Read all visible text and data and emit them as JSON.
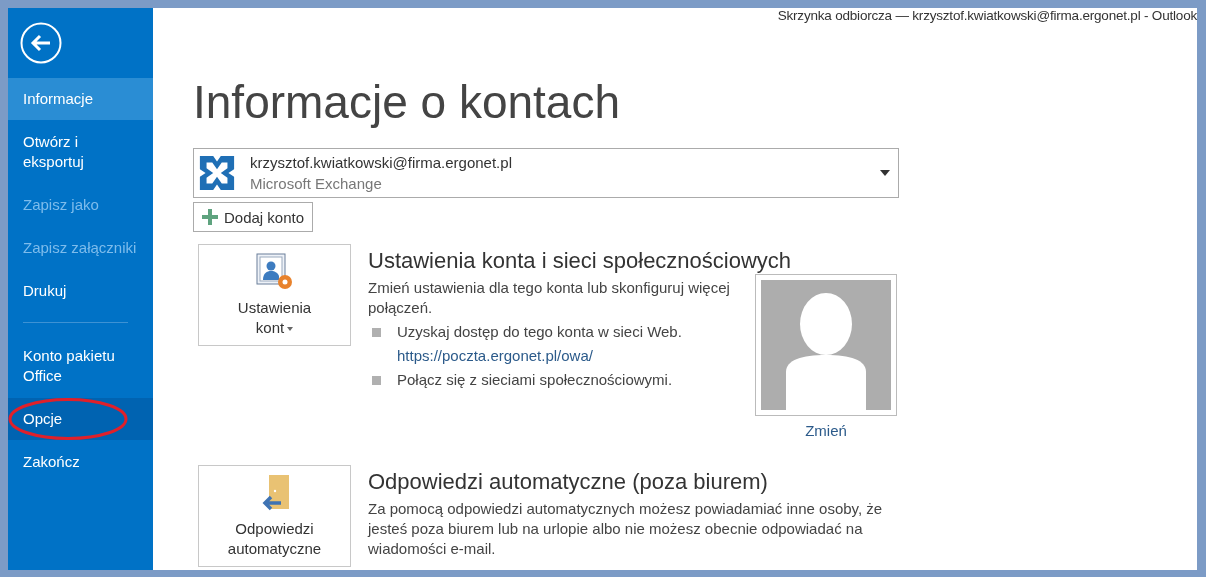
{
  "window": {
    "title": "Skrzynka odbiorcza — krzysztof.kwiatkowski@firma.ergonet.pl - Outlook"
  },
  "sidebar": {
    "items": [
      {
        "label": "Informacje",
        "selected": true,
        "disabled": false,
        "hovered": false,
        "circled": false,
        "divider_after": false
      },
      {
        "label": "Otwórz i eksportuj",
        "selected": false,
        "disabled": false,
        "hovered": false,
        "circled": false,
        "divider_after": false
      },
      {
        "label": "Zapisz jako",
        "selected": false,
        "disabled": true,
        "hovered": false,
        "circled": false,
        "divider_after": false
      },
      {
        "label": "Zapisz załączniki",
        "selected": false,
        "disabled": true,
        "hovered": false,
        "circled": false,
        "divider_after": false
      },
      {
        "label": "Drukuj",
        "selected": false,
        "disabled": false,
        "hovered": false,
        "circled": false,
        "divider_after": true
      },
      {
        "label": "Konto pakietu Office",
        "selected": false,
        "disabled": false,
        "hovered": false,
        "circled": false,
        "divider_after": false
      },
      {
        "label": "Opcje",
        "selected": false,
        "disabled": false,
        "hovered": true,
        "circled": true,
        "divider_after": false
      },
      {
        "label": "Zakończ",
        "selected": false,
        "disabled": false,
        "hovered": false,
        "circled": false,
        "divider_after": false
      }
    ]
  },
  "heading": "Informacje o kontach",
  "account": {
    "email": "krzysztof.kwiatkowski@firma.ergonet.pl",
    "type": "Microsoft Exchange"
  },
  "add_account": "Dodaj konto",
  "sections": [
    {
      "kind": "settings",
      "button": "Ustawienia kont",
      "title": "Ustawienia konta i sieci społecznościowych",
      "description": "Zmień ustawienia dla tego konta lub skonfiguruj więcej połączeń.",
      "bullets": [
        {
          "text": "Uzyskaj dostęp do tego konta w sieci Web.",
          "link": "https://poczta.ergonet.pl/owa/"
        },
        {
          "text": "Połącz się z sieciami społecznościowymi."
        }
      ],
      "photo_link": "Zmień"
    },
    {
      "kind": "autoreply",
      "button": "Odpowiedzi automatyczne",
      "title": "Odpowiedzi automatyczne (poza biurem)",
      "description": "Za pomocą odpowiedzi automatycznych możesz powiadamiać inne osoby, że jesteś poza biurem lub na urlopie albo nie możesz obecnie odpowiadać na wiadomości e-mail."
    }
  ]
}
